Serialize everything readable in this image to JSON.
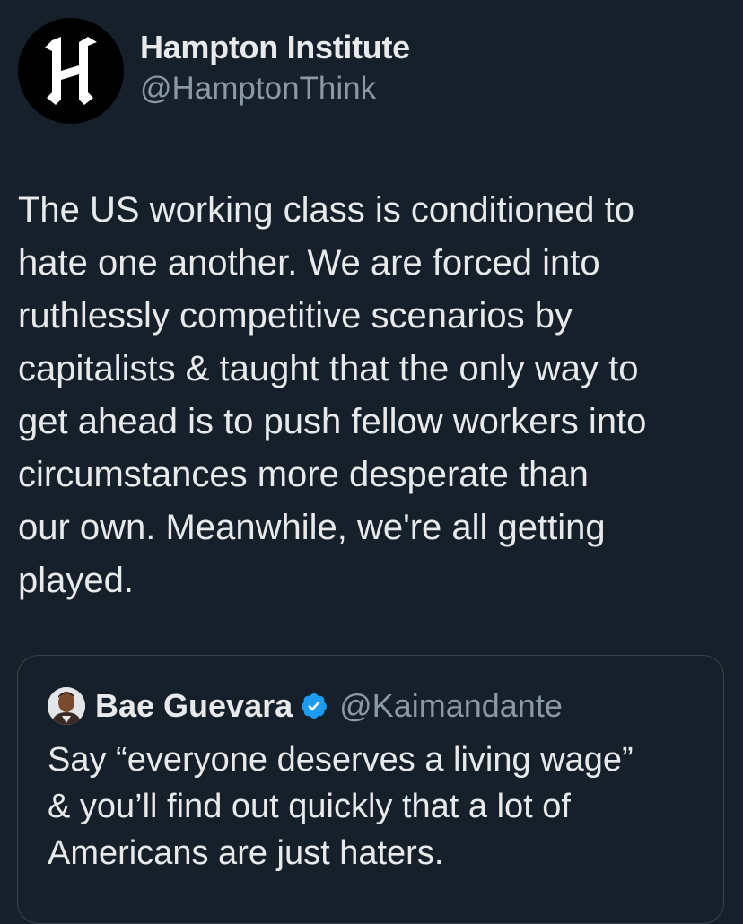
{
  "tweet": {
    "author": {
      "display_name": "Hampton Institute",
      "handle": "@HamptonThink",
      "avatar_icon": "hampton-institute-logo-icon"
    },
    "text": "The US working class is conditioned to\nhate one another. We are forced into\nruthlessly competitive scenarios by\ncapitalists & taught that the only way to\nget ahead is to push fellow workers into\ncircumstances more desperate than\nour own. Meanwhile, we're all getting\nplayed."
  },
  "quoted_tweet": {
    "author": {
      "display_name": "Bae Guevara",
      "handle": "@Kaimandante",
      "verified": true,
      "verified_icon": "verified-badge-icon",
      "avatar_icon": "profile-photo-avatar"
    },
    "text": "Say “everyone deserves a living wage”\n& you’ll find out quickly that a lot of\nAmericans are just haters."
  },
  "colors": {
    "background": "#15202b",
    "text_primary": "#e7e9ea",
    "text_secondary": "#8b98a5",
    "border": "#38444d",
    "verified_blue": "#1d9bf0"
  }
}
